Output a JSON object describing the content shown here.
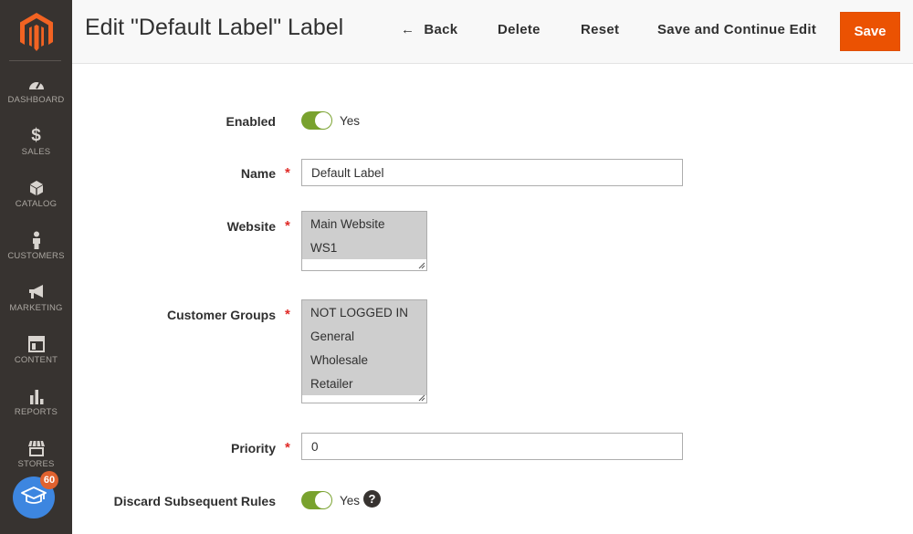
{
  "sidebar": {
    "items": [
      {
        "label": "DASHBOARD",
        "icon": "dashboard-icon"
      },
      {
        "label": "SALES",
        "icon": "dollar-icon"
      },
      {
        "label": "CATALOG",
        "icon": "cube-icon"
      },
      {
        "label": "CUSTOMERS",
        "icon": "person-icon"
      },
      {
        "label": "MARKETING",
        "icon": "megaphone-icon"
      },
      {
        "label": "CONTENT",
        "icon": "layout-icon"
      },
      {
        "label": "REPORTS",
        "icon": "bar-chart-icon"
      },
      {
        "label": "STORES",
        "icon": "storefront-icon"
      }
    ],
    "learn_badge": "60",
    "sales_glyph": "$"
  },
  "header": {
    "title": "Edit \"Default Label\" Label",
    "back_arrow": "←",
    "back_label": "Back",
    "delete_label": "Delete",
    "reset_label": "Reset",
    "save_continue_label": "Save and Continue Edit",
    "save_label": "Save"
  },
  "form": {
    "enabled": {
      "label": "Enabled",
      "value": "Yes",
      "on": true
    },
    "name": {
      "label": "Name",
      "value": "Default Label"
    },
    "website": {
      "label": "Website",
      "options": [
        "Main Website",
        "WS1"
      ]
    },
    "customer_groups": {
      "label": "Customer Groups",
      "options": [
        "NOT LOGGED IN",
        "General",
        "Wholesale",
        "Retailer"
      ]
    },
    "priority": {
      "label": "Priority",
      "value": "0"
    },
    "discard": {
      "label": "Discard Subsequent Rules",
      "value": "Yes",
      "on": true
    },
    "required_mark": "*",
    "help_glyph": "?"
  },
  "colors": {
    "sidebar_bg": "#373330",
    "accent": "#eb5202",
    "toggle_on": "#79a22e",
    "required": "#e02b27",
    "selected_option": "#cecece"
  }
}
